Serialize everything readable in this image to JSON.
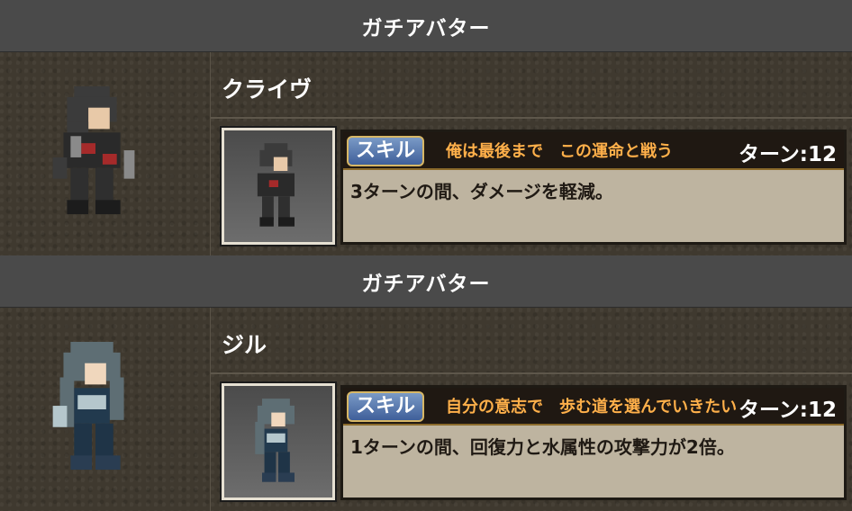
{
  "entries": [
    {
      "header": "ガチアバター",
      "name": "クライヴ",
      "skill_badge": "スキル",
      "skill_name": "俺は最後まで　この運命と戦う",
      "turn_label": "ターン:12",
      "description": "3ターンの間、ダメージを軽減。",
      "sprite_colors": [
        "#3b3b3b",
        "#8a8a8a",
        "#a52a2a",
        "#e8c9a8"
      ]
    },
    {
      "header": "ガチアバター",
      "name": "ジル",
      "skill_badge": "スキル",
      "skill_name": "自分の意志で　歩む道を選んでいきたい",
      "turn_label": "ターン:12",
      "description": "1ターンの間、回復力と水属性の攻撃力が2倍。",
      "sprite_colors": [
        "#5e6e74",
        "#223a4e",
        "#b5c7cc",
        "#f0d7bd"
      ]
    }
  ],
  "colors": {
    "header_bg": "#4a4a4a",
    "skill_name_orange": "#ffb04a",
    "desc_bg": "#beb4a0"
  }
}
